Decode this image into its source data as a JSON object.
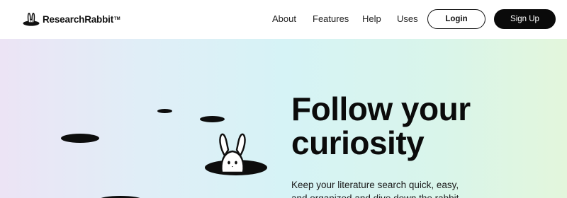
{
  "header": {
    "brand": "ResearchRabbit",
    "trademark": "TM",
    "nav": [
      {
        "label": "About"
      },
      {
        "label": "Features"
      },
      {
        "label": "Help"
      },
      {
        "label": "Uses"
      }
    ],
    "login_label": "Login",
    "signup_label": "Sign Up"
  },
  "hero": {
    "title_line1": "Follow your",
    "title_line2": "curiosity",
    "subtitle": "Keep your literature search quick, easy, and organized and dive down the rabbit"
  },
  "colors": {
    "text": "#111111",
    "signup_bg": "#0a0a0a",
    "hero_gradient_start": "#ece4f5",
    "hero_gradient_mid": "#d6f3f6",
    "hero_gradient_end": "#e3f6dc"
  },
  "icons": {
    "logo": "rabbit-logo-icon",
    "mascot": "rabbit-mascot"
  }
}
